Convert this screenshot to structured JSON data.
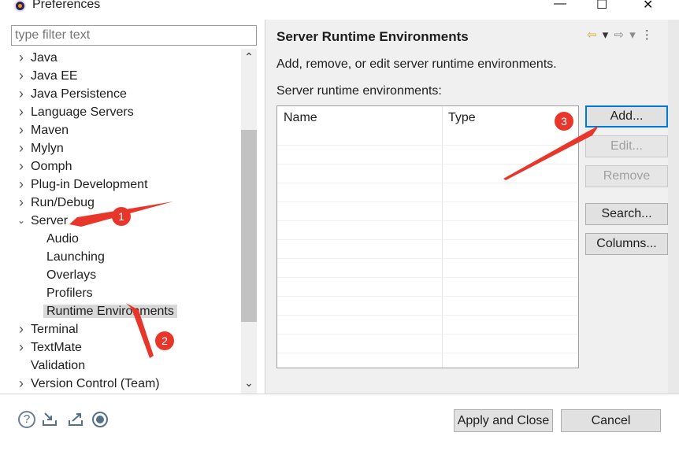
{
  "window": {
    "title": "Preferences",
    "minimize_glyph": "—",
    "maximize_glyph": "☐",
    "close_glyph": "✕"
  },
  "filter": {
    "placeholder": "type filter text"
  },
  "tree": {
    "items": [
      {
        "label": "Java",
        "expander": "›"
      },
      {
        "label": "Java EE",
        "expander": "›"
      },
      {
        "label": "Java Persistence",
        "expander": "›"
      },
      {
        "label": "Language Servers",
        "expander": "›"
      },
      {
        "label": "Maven",
        "expander": "›"
      },
      {
        "label": "Mylyn",
        "expander": "›"
      },
      {
        "label": "Oomph",
        "expander": "›"
      },
      {
        "label": "Plug-in Development",
        "expander": "›"
      },
      {
        "label": "Run/Debug",
        "expander": "›"
      },
      {
        "label": "Server",
        "expander": "⌄"
      },
      {
        "label": "Audio",
        "expander": ""
      },
      {
        "label": "Launching",
        "expander": ""
      },
      {
        "label": "Overlays",
        "expander": ""
      },
      {
        "label": "Profilers",
        "expander": ""
      },
      {
        "label": "Runtime Environments",
        "expander": "",
        "selected": true
      },
      {
        "label": "Terminal",
        "expander": "›"
      },
      {
        "label": "TextMate",
        "expander": "›"
      },
      {
        "label": "Validation",
        "expander": ""
      },
      {
        "label": "Version Control (Team)",
        "expander": "›"
      }
    ]
  },
  "page": {
    "title": "Server Runtime Environments",
    "description": "Add, remove, or edit server runtime environments.",
    "section_label": "Server runtime environments:",
    "table": {
      "columns": [
        "Name",
        "Type"
      ]
    },
    "buttons": {
      "add": "Add...",
      "edit": "Edit...",
      "remove": "Remove",
      "search": "Search...",
      "columns": "Columns..."
    },
    "nav": {
      "back": "⇦",
      "forward": "⇨",
      "dropdown": "▾",
      "menu": "⋮"
    }
  },
  "footer": {
    "apply_close": "Apply and Close",
    "cancel": "Cancel",
    "help_glyph": "?"
  },
  "annotations": {
    "badge1": "1",
    "badge2": "2",
    "badge3": "3",
    "color": "#e8362b"
  }
}
